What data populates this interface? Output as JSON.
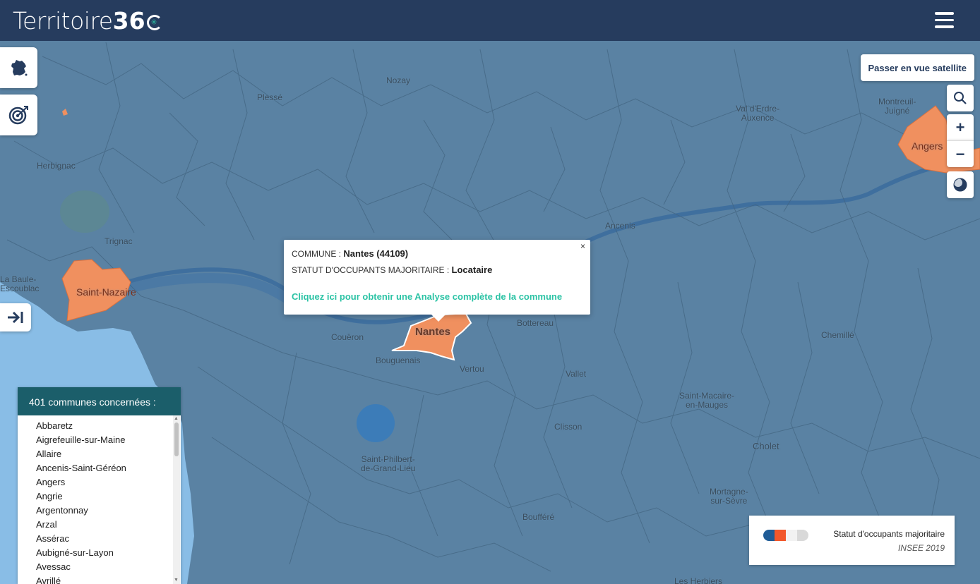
{
  "app": {
    "logo_text": "Territoire",
    "logo_number": "36"
  },
  "map": {
    "places": [
      {
        "name": "Nozay"
      },
      {
        "name": "Plessé"
      },
      {
        "name": "Herbignac"
      },
      {
        "name": "Val d'Erdre-\nAuxence"
      },
      {
        "name": "Montreuil-\nJuigné"
      },
      {
        "name": "Angers"
      },
      {
        "name": "Trignac"
      },
      {
        "name": "La Baule-\nEscoublac"
      },
      {
        "name": "Saint-Nazaire"
      },
      {
        "name": "Ancenis"
      },
      {
        "name": "Couëron"
      },
      {
        "name": "Nantes"
      },
      {
        "name": "Bouguenais"
      },
      {
        "name": "Vertou"
      },
      {
        "name": "Bottereau"
      },
      {
        "name": "Vallet"
      },
      {
        "name": "Chemillé"
      },
      {
        "name": "Saint-Macaire-\nen-Mauges"
      },
      {
        "name": "Clisson"
      },
      {
        "name": "Cholet"
      },
      {
        "name": "Saint-Philbert-\nde-Grand-Lieu"
      },
      {
        "name": "Mortagne-\nsur-Sèvre"
      },
      {
        "name": "Boufféré"
      },
      {
        "name": "Les Herbiers"
      }
    ]
  },
  "controls": {
    "france_icon": "france-map-icon",
    "target_icon": "target-icon",
    "sidebar_toggle_icon": "arrow-to-bar-icon",
    "satellite_label": "Passer en vue satellite",
    "search_icon": "search-icon",
    "zoom_in_label": "+",
    "zoom_out_label": "−",
    "layer_icon": "layer-toggle-icon"
  },
  "popup": {
    "commune_label": "COMMUNE : ",
    "commune_value": "Nantes (44109)",
    "statut_label": "STATUT D'OCCUPANTS MAJORITAIRE : ",
    "statut_value": "Locataire",
    "link_text": "Cliquez ici pour obtenir une Analyse complète de la commune",
    "close_label": "×"
  },
  "communes": {
    "title": "401 communes concernées :",
    "items": [
      "Abbaretz",
      "Aigrefeuille-sur-Maine",
      "Allaire",
      "Ancenis-Saint-Géréon",
      "Angers",
      "Angrie",
      "Argentonnay",
      "Arzal",
      "Assérac",
      "Aubigné-sur-Layon",
      "Avessac",
      "Avrillé"
    ]
  },
  "legend": {
    "title": "Statut d'occupants majoritaire",
    "source": "INSEE 2019",
    "colors": [
      "#1f5c96",
      "#f2572b",
      "#f2f2f2",
      "#d9d9d9"
    ]
  },
  "colors": {
    "header": "#263c5e",
    "accent": "#2cc3a5",
    "highlight": "#f0905f",
    "map_base": "#5a82a3",
    "sea": "#89bde6"
  }
}
